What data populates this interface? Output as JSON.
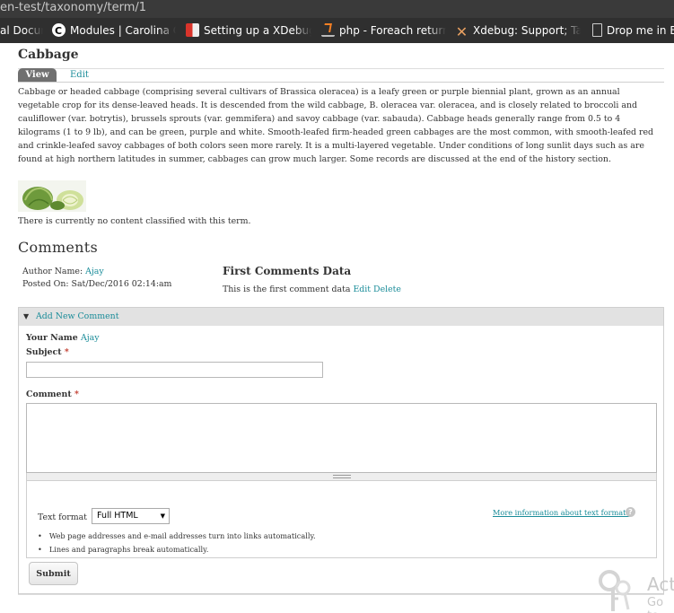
{
  "browser": {
    "url": "en-test/taxonomy/term/1",
    "bookmarks": [
      {
        "label": "al Docum",
        "icon": "document-icon"
      },
      {
        "label": "Modules | Carolina Cy",
        "icon": "carolina-logo-icon"
      },
      {
        "label": "Setting up a XDebug c",
        "icon": "xdebug-favicon-icon"
      },
      {
        "label": "php - Foreach returns",
        "icon": "stackoverflow-icon"
      },
      {
        "label": "Xdebug: Support; Tail",
        "icon": "xdebug-x-icon"
      },
      {
        "label": "Drop me in Bo",
        "icon": "document-icon"
      }
    ]
  },
  "page": {
    "title": "Cabbage",
    "tabs": {
      "view": "View",
      "edit": "Edit"
    },
    "description": "Cabbage or headed cabbage (comprising several cultivars of Brassica oleracea) is a leafy green or purple biennial plant, grown as an annual vegetable crop for its dense-leaved heads. It is descended from the wild cabbage, B. oleracea var. oleracea, and is closely related to broccoli and cauliflower (var. botrytis), brussels sprouts (var. gemmifera) and savoy cabbage (var. sabauda). Cabbage heads generally range from 0.5 to 4 kilograms (1 to 9 lb), and can be green, purple and white. Smooth-leafed firm-headed green cabbages are the most common, with smooth-leafed red and crinkle-leafed savoy cabbages of both colors seen more rarely. It is a multi-layered vegetable. Under conditions of long sunlit days such as are found at high northern latitudes in summer, cabbages can grow much larger. Some records are discussed at the end of the history section.",
    "empty_notice": "There is currently no content classified with this term."
  },
  "comments": {
    "heading": "Comments",
    "items": [
      {
        "author_label": "Author Name:",
        "author": "Ajay",
        "posted_label": "Posted On:",
        "posted": "Sat/Dec/2016 02:14:am",
        "title": "First Comments Data",
        "body": "This is the first comment data",
        "edit_label": "Edit",
        "delete_label": "Delete"
      }
    ]
  },
  "form": {
    "panel_title": "Add New Comment",
    "your_name_label": "Your Name",
    "your_name": "Ajay",
    "subject_label": "Subject",
    "subject_value": "",
    "comment_label": "Comment",
    "comment_value": "",
    "required_mark": "*",
    "text_format_label": "Text format",
    "text_format_value": "Full HTML",
    "more_info": "More information about text formats",
    "tips": [
      "Web page addresses and e-mail addresses turn into links automatically.",
      "Lines and paragraphs break automatically."
    ],
    "submit_label": "Submit"
  },
  "watermark": {
    "line1": "Act",
    "line2": "Go to"
  }
}
